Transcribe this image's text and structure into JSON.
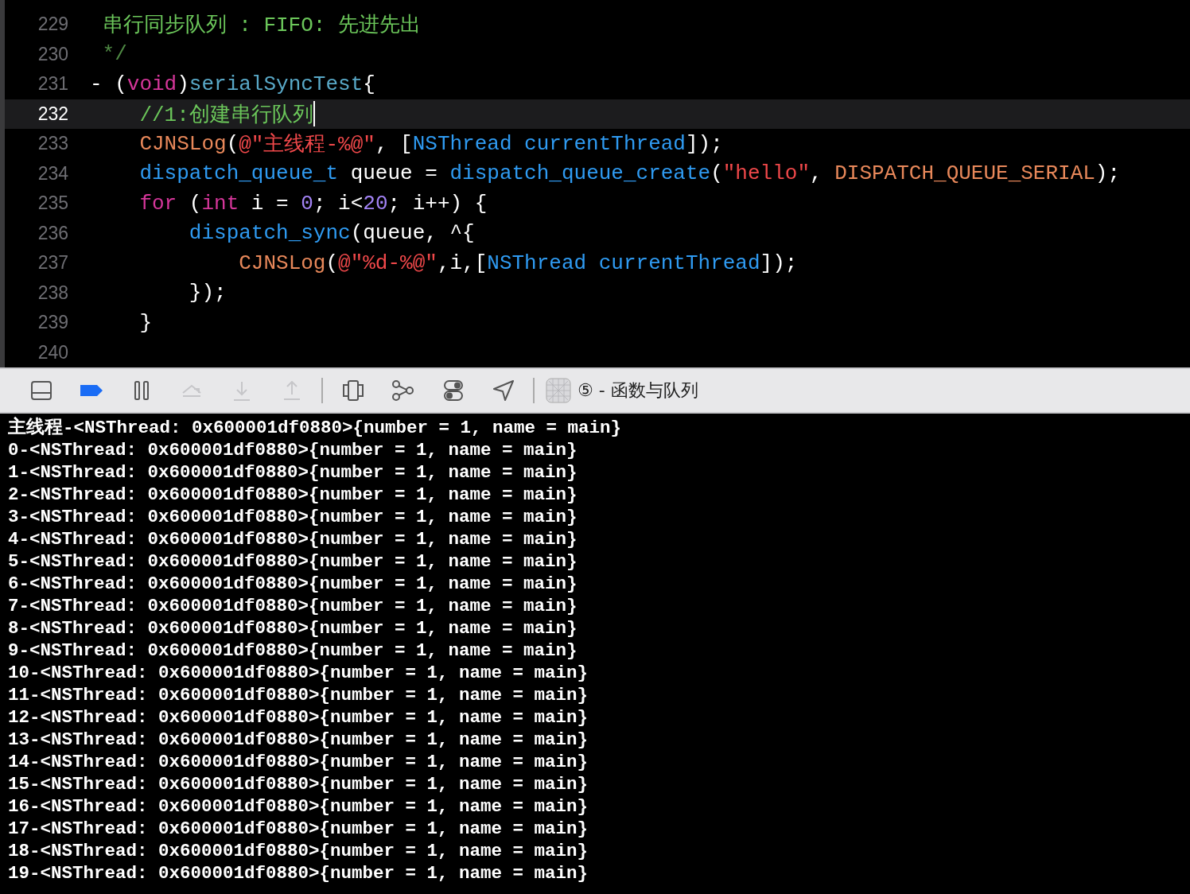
{
  "editor": {
    "lines": [
      {
        "number": "229",
        "selected": false,
        "tokens": [
          {
            "kind": "comment",
            "text": " 串行同步队列 : FIFO: 先进先出"
          }
        ]
      },
      {
        "number": "230",
        "selected": false,
        "tokens": [
          {
            "kind": "comment-dim",
            "text": " */"
          }
        ]
      },
      {
        "number": "231",
        "selected": false,
        "tokens": [
          {
            "kind": "plain",
            "text": "- ("
          },
          {
            "kind": "keyword",
            "text": "void"
          },
          {
            "kind": "plain",
            "text": ")"
          },
          {
            "kind": "method",
            "text": "serialSyncTest"
          },
          {
            "kind": "plain",
            "text": "{"
          }
        ]
      },
      {
        "number": "232",
        "selected": true,
        "tokens": [
          {
            "kind": "comment",
            "text": "    //1:创建串行队列"
          }
        ]
      },
      {
        "number": "233",
        "selected": false,
        "tokens": [
          {
            "kind": "macro",
            "text": "    CJNSLog"
          },
          {
            "kind": "plain",
            "text": "("
          },
          {
            "kind": "string",
            "text": "@\"主线程-%@\""
          },
          {
            "kind": "plain",
            "text": ", ["
          },
          {
            "kind": "type",
            "text": "NSThread currentThread"
          },
          {
            "kind": "plain",
            "text": "]);"
          }
        ]
      },
      {
        "number": "234",
        "selected": false,
        "tokens": [
          {
            "kind": "type",
            "text": "    dispatch_queue_t"
          },
          {
            "kind": "plain",
            "text": " queue = "
          },
          {
            "kind": "type",
            "text": "dispatch_queue_create"
          },
          {
            "kind": "plain",
            "text": "("
          },
          {
            "kind": "string",
            "text": "\"hello\""
          },
          {
            "kind": "plain",
            "text": ", "
          },
          {
            "kind": "macro",
            "text": "DISPATCH_QUEUE_SERIAL"
          },
          {
            "kind": "plain",
            "text": ");"
          }
        ]
      },
      {
        "number": "235",
        "selected": false,
        "tokens": [
          {
            "kind": "keyword",
            "text": "    for"
          },
          {
            "kind": "plain",
            "text": " ("
          },
          {
            "kind": "keyword",
            "text": "int"
          },
          {
            "kind": "plain",
            "text": " i = "
          },
          {
            "kind": "number",
            "text": "0"
          },
          {
            "kind": "plain",
            "text": "; i<"
          },
          {
            "kind": "number",
            "text": "20"
          },
          {
            "kind": "plain",
            "text": "; i++) {"
          }
        ]
      },
      {
        "number": "236",
        "selected": false,
        "tokens": [
          {
            "kind": "type",
            "text": "        dispatch_sync"
          },
          {
            "kind": "plain",
            "text": "(queue, ^{"
          }
        ]
      },
      {
        "number": "237",
        "selected": false,
        "tokens": [
          {
            "kind": "macro",
            "text": "            CJNSLog"
          },
          {
            "kind": "plain",
            "text": "("
          },
          {
            "kind": "string",
            "text": "@\"%d-%@\""
          },
          {
            "kind": "plain",
            "text": ",i,["
          },
          {
            "kind": "type",
            "text": "NSThread currentThread"
          },
          {
            "kind": "plain",
            "text": "]);"
          }
        ]
      },
      {
        "number": "238",
        "selected": false,
        "tokens": [
          {
            "kind": "plain",
            "text": "        });"
          }
        ]
      },
      {
        "number": "239",
        "selected": false,
        "tokens": [
          {
            "kind": "plain",
            "text": "    }"
          }
        ]
      },
      {
        "number": "240",
        "selected": false
      }
    ]
  },
  "debug_bar": {
    "groups": [
      {
        "buttons": [
          {
            "kind": "panel",
            "disabled": false
          },
          {
            "kind": "breakpoints",
            "disabled": false
          },
          {
            "kind": "pause",
            "disabled": false
          },
          {
            "kind": "step-over",
            "disabled": true
          },
          {
            "kind": "step-into",
            "disabled": true
          },
          {
            "kind": "step-out",
            "disabled": true
          }
        ]
      },
      {
        "buttons": [
          {
            "kind": "view-debugger",
            "disabled": false
          },
          {
            "kind": "memory-graph",
            "disabled": false
          },
          {
            "kind": "toggles",
            "disabled": false
          },
          {
            "kind": "location",
            "disabled": false
          }
        ]
      }
    ],
    "target": "⑤ - 函数与队列"
  },
  "console": {
    "lines": [
      "主线程-<NSThread: 0x600001df0880>{number = 1, name = main}",
      "0-<NSThread: 0x600001df0880>{number = 1, name = main}",
      "1-<NSThread: 0x600001df0880>{number = 1, name = main}",
      "2-<NSThread: 0x600001df0880>{number = 1, name = main}",
      "3-<NSThread: 0x600001df0880>{number = 1, name = main}",
      "4-<NSThread: 0x600001df0880>{number = 1, name = main}",
      "5-<NSThread: 0x600001df0880>{number = 1, name = main}",
      "6-<NSThread: 0x600001df0880>{number = 1, name = main}",
      "7-<NSThread: 0x600001df0880>{number = 1, name = main}",
      "8-<NSThread: 0x600001df0880>{number = 1, name = main}",
      "9-<NSThread: 0x600001df0880>{number = 1, name = main}",
      "10-<NSThread: 0x600001df0880>{number = 1, name = main}",
      "11-<NSThread: 0x600001df0880>{number = 1, name = main}",
      "12-<NSThread: 0x600001df0880>{number = 1, name = main}",
      "13-<NSThread: 0x600001df0880>{number = 1, name = main}",
      "14-<NSThread: 0x600001df0880>{number = 1, name = main}",
      "15-<NSThread: 0x600001df0880>{number = 1, name = main}",
      "16-<NSThread: 0x600001df0880>{number = 1, name = main}",
      "17-<NSThread: 0x600001df0880>{number = 1, name = main}",
      "18-<NSThread: 0x600001df0880>{number = 1, name = main}",
      "19-<NSThread: 0x600001df0880>{number = 1, name = main}"
    ]
  }
}
